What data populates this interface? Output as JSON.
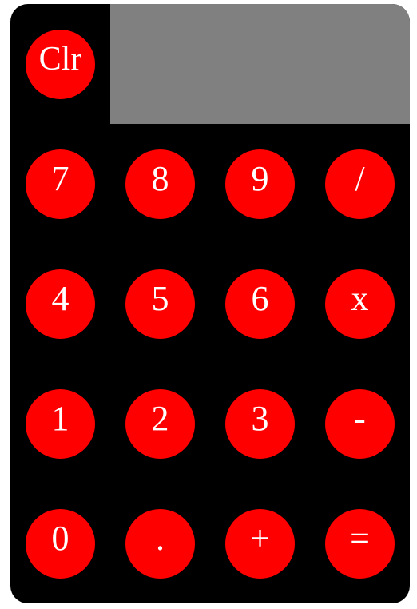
{
  "display": {
    "value": ""
  },
  "buttons": {
    "clear": "Clr",
    "seven": "7",
    "eight": "8",
    "nine": "9",
    "divide": "/",
    "four": "4",
    "five": "5",
    "six": "6",
    "multiply": "x",
    "one": "1",
    "two": "2",
    "three": "3",
    "subtract": "-",
    "zero": "0",
    "decimal": ".",
    "add": "+",
    "equals": "="
  },
  "colors": {
    "body": "#000000",
    "display": "#808080",
    "button": "#ff0000",
    "button_text": "#ffffff"
  }
}
